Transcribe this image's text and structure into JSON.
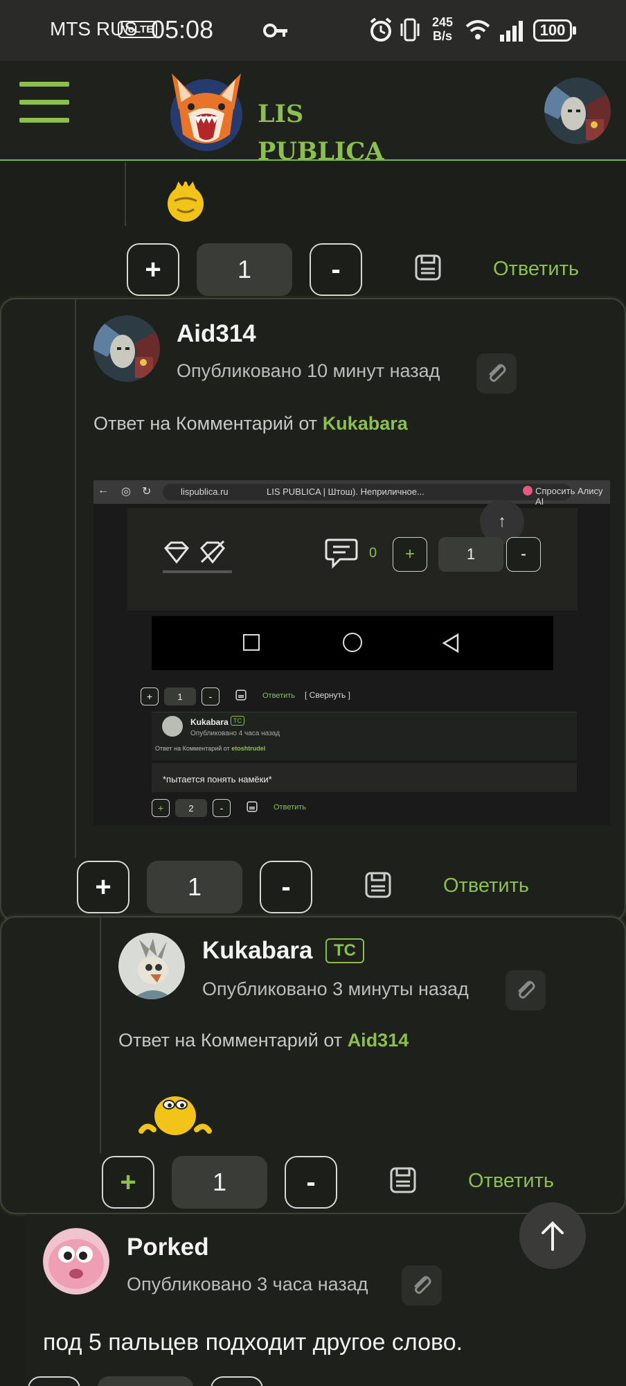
{
  "status_bar": {
    "carrier": "MTS RUS",
    "volte": "VoLTE",
    "time": "05:08",
    "speed_top": "245",
    "speed_bottom": "B/s",
    "battery": "100"
  },
  "header": {
    "brand_line1": "LIS",
    "brand_line2": "PUBLICA"
  },
  "top_actions": {
    "plus": "+",
    "count": "1",
    "minus": "-",
    "reply": "Ответить"
  },
  "comments": [
    {
      "author": "Aid314",
      "posted": "Опубликовано 10 минут назад",
      "reply_prefix": "Ответ на Комментарий от",
      "reply_to": "Kukabara",
      "plus": "+",
      "count": "1",
      "minus": "-",
      "reply": "Ответить"
    },
    {
      "author": "Kukabara",
      "badge": "ТС",
      "posted": "Опубликовано 3 минуты назад",
      "reply_prefix": "Ответ на Комментарий от",
      "reply_to": "Aid314",
      "plus": "+",
      "count": "1",
      "minus": "-",
      "reply": "Ответить"
    },
    {
      "author": "Porked",
      "posted": "Опубликовано 3 часа назад",
      "text": "под 5 пальцев подходит другое слово."
    }
  ],
  "screenshot": {
    "url": "lispublica.ru",
    "tab_title": "LIS PUBLICA | Штош). Неприличное...",
    "assistant": "Спросить Алису AI",
    "comments_count": "0",
    "plus": "+",
    "count1": "1",
    "minus": "-",
    "reply": "Ответить",
    "collapse": "[ Свернуть ]",
    "author": "Kukabara",
    "badge": "ТС",
    "posted": "Опубликовано 4 часа назад",
    "reply_prefix": "Ответ на Комментарий от",
    "reply_to": "etoshtrudel",
    "text": "*пытается понять намёки*",
    "count2": "2"
  },
  "colors": {
    "accent": "#8cc04e",
    "background": "#1c1e1a",
    "card": "#1e201c"
  }
}
